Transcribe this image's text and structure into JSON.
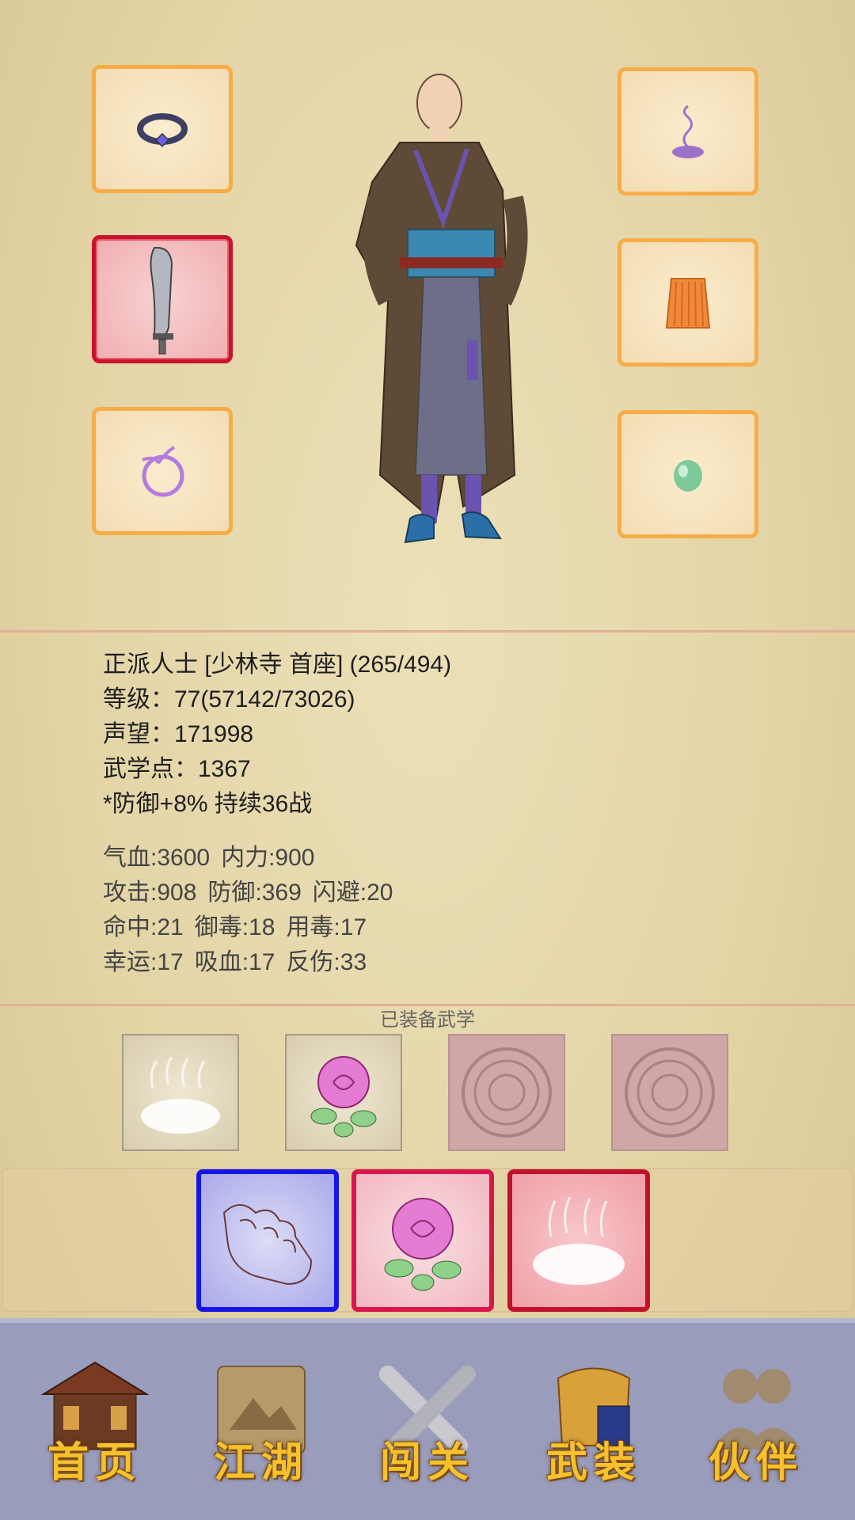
{
  "character": {
    "title_line": "正派人士 [少林寺 首座] (265/494)",
    "level_line": "等级：77(57142/73026)",
    "fame_line": "声望：171998",
    "points_line": "武学点：1367",
    "buff_line": "*防御+8% 持续36战"
  },
  "stats": {
    "row1": [
      "气血:3600",
      "内力:900"
    ],
    "row2": [
      "攻击:908",
      "防御:369",
      "闪避:20"
    ],
    "row3": [
      "命中:21",
      "御毒:18",
      "用毒:17"
    ],
    "row4": [
      "幸运:17",
      "吸血:17",
      "反伤:33"
    ]
  },
  "equipment": {
    "left": [
      "ring-icon",
      "sword-icon",
      "bracelet-icon"
    ],
    "right": [
      "incense-icon",
      "skirt-armor-icon",
      "jade-icon"
    ],
    "selected": "sword-icon"
  },
  "martial": {
    "section_title": "已装备武学",
    "equipped": [
      "mist-icon",
      "rose-icon",
      "locked-seal-icon",
      "locked-seal-icon"
    ],
    "skill_bar": [
      "fist-icon",
      "rose-icon",
      "mist-icon"
    ]
  },
  "nav": {
    "home": "首页",
    "jianghu": "江湖",
    "challenge": "闯关",
    "equip": "武装",
    "partner": "伙伴"
  },
  "colors": {
    "slot_border": "#f5ad4a",
    "selected_border": "#c8142a",
    "nav_bg": "#9a9cbc",
    "nav_text": "#f6c12c"
  }
}
